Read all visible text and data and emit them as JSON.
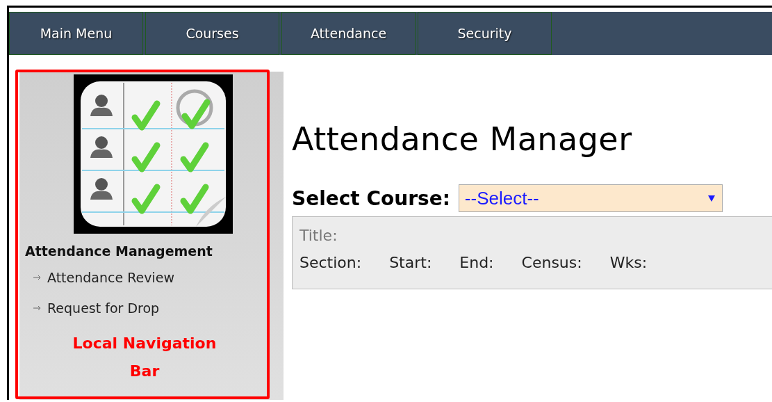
{
  "nav_tabs": [
    {
      "label": "Main Menu",
      "selected": false
    },
    {
      "label": "Courses",
      "selected": false
    },
    {
      "label": "Attendance",
      "selected": false
    },
    {
      "label": "Security",
      "selected": false
    }
  ],
  "sidebar": {
    "heading": "Attendance Management",
    "items": [
      {
        "label": "Attendance Review"
      },
      {
        "label": "Request for Drop"
      }
    ]
  },
  "annotation": {
    "lines": [
      "Local Navigation",
      "Bar"
    ]
  },
  "main": {
    "title": "Attendance Manager",
    "course_label": "Select Course:",
    "course_select": {
      "value": "--Select--"
    },
    "info": {
      "title_label": "Title:",
      "fields": [
        "Section:",
        "Start:",
        "End:",
        "Census:",
        "Wks:"
      ]
    }
  }
}
